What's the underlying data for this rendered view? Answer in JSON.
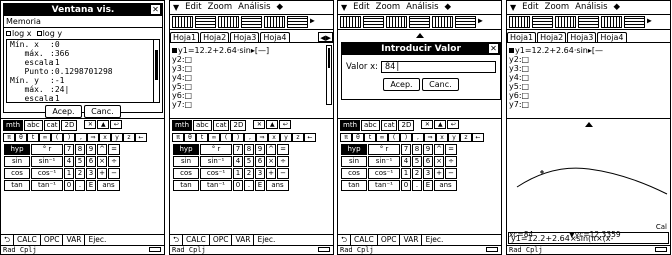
{
  "s1": {
    "dialog_title": "Ventana vis.",
    "memoria": "Memoria",
    "log_x": "log x",
    "log_y": "log y",
    "fields": [
      {
        "k": "Mín. x",
        "v": ":0"
      },
      {
        "k": "   máx.",
        "v": ":366"
      },
      {
        "k": "   escala",
        "v": ":1"
      },
      {
        "k": "   Punto",
        "v": ":0.1298701298"
      },
      {
        "k": "Mín. y",
        "v": ":-1"
      },
      {
        "k": "   máx.",
        "v": ":24"
      },
      {
        "k": "   escala",
        "v": ":1"
      }
    ],
    "ok": "Acep.",
    "cancel": "Canc."
  },
  "menu": {
    "edit": "Edit",
    "zoom": "Zoom",
    "analysis": "Análisis"
  },
  "tabs": [
    "Hoja1",
    "Hoja2",
    "Hoja3",
    "Hoja4"
  ],
  "func_y1": "y1=12.2+2.64·sin",
  "func_rest": [
    "y2:□",
    "y3:□",
    "y4:□",
    "y5:□",
    "y6:□",
    "y7:□"
  ],
  "keyboard": {
    "tabs": [
      "mth",
      "abc",
      "cat",
      "2D"
    ],
    "row1": [
      "π",
      "θ",
      "t",
      "∞",
      "(",
      ")",
      ",",
      "⇒",
      "x",
      "y",
      "z",
      "t",
      "←"
    ],
    "hyp": "hyp",
    "deg": "°",
    "rad": "r",
    "rows": [
      [
        "sin",
        "sin⁻¹",
        "4",
        "5",
        "6",
        "×",
        "÷"
      ],
      [
        "cos",
        "cos⁻¹",
        "1",
        "2",
        "3",
        "+",
        "−"
      ],
      [
        "tan",
        "tan⁻¹",
        "0",
        ".",
        "E",
        "ans"
      ]
    ],
    "top_nums": [
      "7",
      "8",
      "9",
      "^",
      "="
    ],
    "bottom": [
      "CALC",
      "OPC",
      "VAR",
      "Ejec."
    ]
  },
  "status": {
    "mode": "Rad",
    "cplx": "Cplj"
  },
  "s3": {
    "dialog_title": "Introducir Valor",
    "label": "Valor x:",
    "value": "84",
    "ok": "Acep.",
    "cancel": "Canc."
  },
  "s4": {
    "xc": "xc=84",
    "yc": "yc=12.3359",
    "cal": "Cal",
    "entry": "y1=12.2+2.64×sin(π×(x-"
  }
}
